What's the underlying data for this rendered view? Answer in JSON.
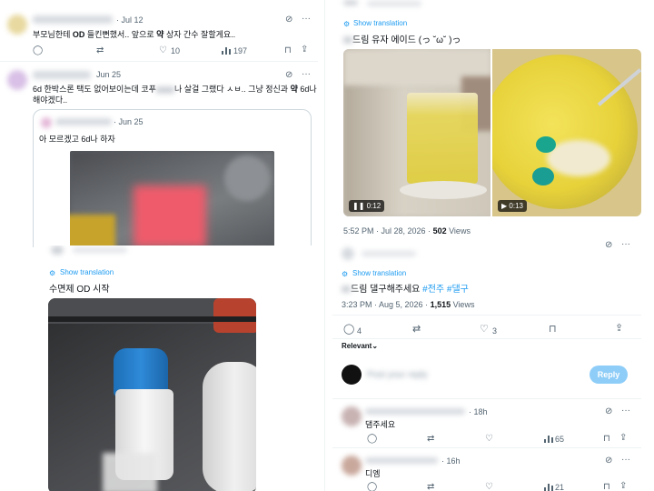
{
  "p1": {
    "tweet1": {
      "date": "· Jul 12",
      "text_a": "부모님한테 ",
      "text_b": "OD",
      "text_c": " 들킨뻔했서.. 앞으로 ",
      "text_d": "약",
      "text_e": " 상자 간수 잘할게요..",
      "likes": "10",
      "views": "197"
    },
    "tweet2": {
      "date": "Jun 25",
      "text_line1_a": "6d 한박스론 택도 없어보이는데 코푸",
      "text_line1_b": "나 살걸 그랬다 ㅅㅂ.. 그냥 정신과 ",
      "text_line1_c": "약",
      "text_line1_d": " 6d나",
      "text_line2": "해야겠다..",
      "quote_date": "· Jun 25",
      "quote_text": "아 모르겠고 6d나 하자"
    }
  },
  "p2": {
    "show_translation": "Show translation",
    "text": "드림 유자 에이드 (っ ˘ω˘ )っ",
    "video1_time": "0:12",
    "video2_time": "0:13",
    "meta": "5:52 PM · Jul 28, 2026 · ",
    "views_count": "502",
    "views_label": " Views"
  },
  "p3": {
    "show_translation": "Show translation",
    "text": "수면제 OD 시작"
  },
  "p4": {
    "show_translation": "Show translation",
    "text_a": "드림 댈구해주세요 ",
    "hashtag1": "#전주",
    "hashtag2": "#댈구",
    "meta": "3:23 PM · Aug 5, 2026 · ",
    "views_count": "1,515",
    "views_label": " Views",
    "replies": "4",
    "likes": "3",
    "relevant": "Relevant",
    "reply_placeholder": "Post your reply",
    "reply_button": "Reply",
    "reply1": {
      "time": "· 18h",
      "text": "댐주세요",
      "views": "65"
    },
    "reply2": {
      "time": "· 16h",
      "text": "디엠",
      "views": "21"
    }
  },
  "colors": {
    "accent": "#1d9bf0",
    "muted": "#536471",
    "reply_btn_bg": "#8ecdf8"
  }
}
